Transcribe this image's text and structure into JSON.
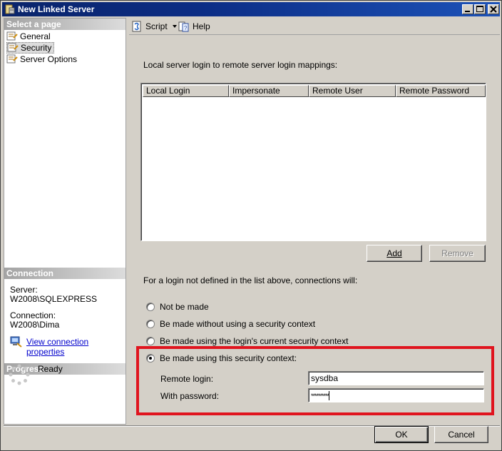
{
  "window": {
    "title": "New Linked Server"
  },
  "left": {
    "select_page_header": "Select a page",
    "pages": [
      {
        "label": "General"
      },
      {
        "label": "Security"
      },
      {
        "label": "Server Options"
      }
    ],
    "connection_header": "Connection",
    "server_label": "Server:",
    "server_value": "W2008\\SQLEXPRESS",
    "connection_label": "Connection:",
    "connection_value": "W2008\\Dima",
    "view_link": "View connection properties",
    "progress_header": "Progress",
    "status": "Ready"
  },
  "toolbar": {
    "script_label": "Script",
    "help_label": "Help"
  },
  "security": {
    "mapping_label": "Local server login to remote server login mappings:",
    "columns": [
      "Local Login",
      "Impersonate",
      "Remote User",
      "Remote Password"
    ],
    "add_label": "Add",
    "remove_label": "Remove",
    "connections_label": "For a login not defined in the list above, connections will:",
    "options": [
      "Not be made",
      "Be made without using a security context",
      "Be made using the login's current security context",
      "Be made using this security context:"
    ],
    "selected_option": 3,
    "remote_login_label": "Remote login:",
    "remote_login_value": "sysdba",
    "password_label": "With password:",
    "password_value": "**********"
  },
  "buttons": {
    "ok": "OK",
    "cancel": "Cancel"
  },
  "colors": {
    "highlight": "#e0141e",
    "title_bar": "#0a246a",
    "link": "#0000cc"
  }
}
